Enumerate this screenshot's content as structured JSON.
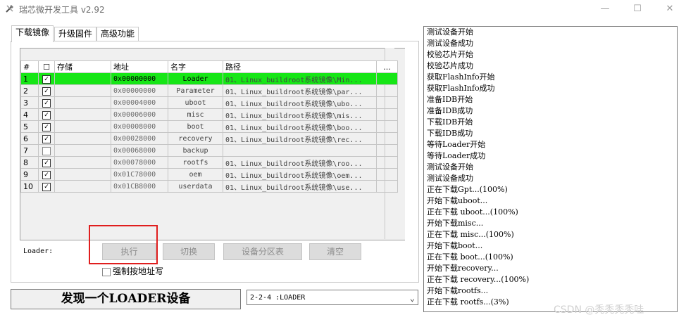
{
  "window": {
    "title": "瑞芯微开发工具 v2.92",
    "min": "—",
    "max": "☐",
    "close": "✕"
  },
  "tabs": [
    "下载镜像",
    "升级固件",
    "高级功能"
  ],
  "grid": {
    "headers": [
      "#",
      "☐",
      "存储",
      "地址",
      "名字",
      "路径",
      "..."
    ],
    "rows": [
      {
        "n": "1",
        "checked": true,
        "addr": "0x00000000",
        "name": "Loader",
        "path": "01、Linux_buildroot系统镜像\\Min...",
        "selected": true
      },
      {
        "n": "2",
        "checked": true,
        "addr": "0x00000000",
        "name": "Parameter",
        "path": "01、Linux_buildroot系统镜像\\par...",
        "selected": false
      },
      {
        "n": "3",
        "checked": true,
        "addr": "0x00004000",
        "name": "uboot",
        "path": "01、Linux_buildroot系统镜像\\ubo...",
        "selected": false
      },
      {
        "n": "4",
        "checked": true,
        "addr": "0x00006000",
        "name": "misc",
        "path": "01、Linux_buildroot系统镜像\\mis...",
        "selected": false
      },
      {
        "n": "5",
        "checked": true,
        "addr": "0x00008000",
        "name": "boot",
        "path": "01、Linux_buildroot系统镜像\\boo...",
        "selected": false
      },
      {
        "n": "6",
        "checked": true,
        "addr": "0x00028000",
        "name": "recovery",
        "path": "01、Linux_buildroot系统镜像\\rec...",
        "selected": false
      },
      {
        "n": "7",
        "checked": false,
        "addr": "0x00068000",
        "name": "backup",
        "path": "",
        "selected": false
      },
      {
        "n": "8",
        "checked": true,
        "addr": "0x00078000",
        "name": "rootfs",
        "path": "01、Linux_buildroot系统镜像\\roo...",
        "selected": false
      },
      {
        "n": "9",
        "checked": true,
        "addr": "0x01C78000",
        "name": "oem",
        "path": "01、Linux_buildroot系统镜像\\oem...",
        "selected": false
      },
      {
        "n": "10",
        "checked": true,
        "addr": "0x01CB8000",
        "name": "userdata",
        "path": "01、Linux_buildroot系统镜像\\use...",
        "selected": false
      }
    ]
  },
  "loader_label": "Loader:",
  "buttons": {
    "execute": "执行",
    "switch": "切换",
    "partition": "设备分区表",
    "clear": "清空"
  },
  "force_addr": "强制按地址写",
  "status": "发现一个LOADER设备",
  "device_select": "2-2-4 :LOADER",
  "log": [
    "测试设备开始",
    "测试设备成功",
    "校验芯片开始",
    "校验芯片成功",
    "获取FlashInfo开始",
    "获取FlashInfo成功",
    "准备IDB开始",
    "准备IDB成功",
    "下载IDB开始",
    "下载IDB成功",
    "等待Loader开始",
    "等待Loader成功",
    "测试设备开始",
    "测试设备成功",
    "正在下载Gpt...(100%)",
    "开始下载uboot...",
    "正在下载 uboot...(100%)",
    "开始下载misc...",
    "正在下载 misc...(100%)",
    "开始下载boot...",
    "正在下载 boot...(100%)",
    "开始下载recovery...",
    "正在下载 recovery...(100%)",
    "开始下载rootfs...",
    "正在下载 rootfs...(3%)"
  ],
  "watermark": "CSDN @秃秃秃秃哇"
}
